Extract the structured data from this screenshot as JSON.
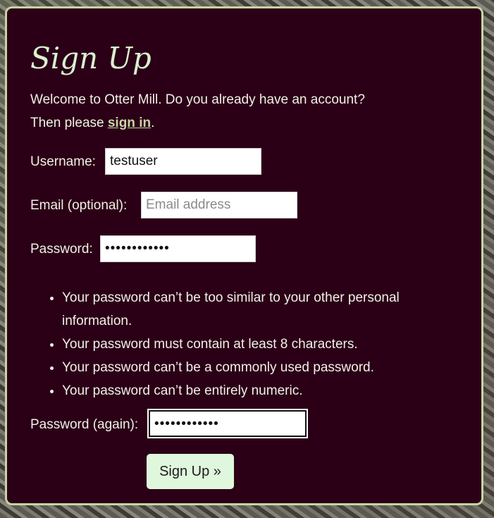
{
  "page": {
    "title": "Sign Up",
    "intro_line1": "Welcome to Otter Mill. Do you already have an account?",
    "intro_line2_prefix": "Then please ",
    "sign_in_link": "sign in",
    "intro_line2_suffix": "."
  },
  "form": {
    "username": {
      "label": "Username:",
      "value": "testuser"
    },
    "email": {
      "label": "Email (optional):",
      "placeholder": "Email address",
      "value": ""
    },
    "password": {
      "label": "Password:",
      "masked_value": "••••••••••••"
    },
    "password_rules": [
      "Your password can’t be too similar to your other personal information.",
      "Your password must contain at least 8 characters.",
      "Your password can’t be a commonly used password.",
      "Your password can’t be entirely numeric."
    ],
    "password_again": {
      "label": "Password (again):",
      "masked_value": "••••••••••••"
    },
    "submit_label": "Sign Up »"
  },
  "colors": {
    "card_background": "#2b0017",
    "card_border": "#c8d3a3",
    "title": "#d9f0cf",
    "link": "#c8d3a3",
    "button_background": "#dff7dc"
  }
}
